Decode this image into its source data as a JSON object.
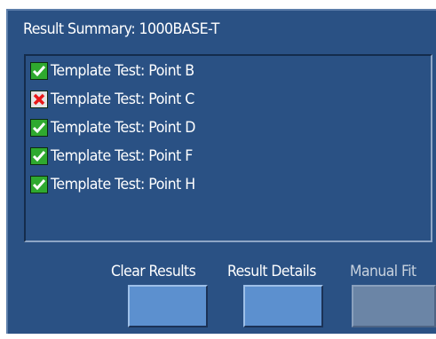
{
  "panel": {
    "title": "Result Summary: 1000BASE-T"
  },
  "results": [
    {
      "label": "Template Test: Point B",
      "status": "pass",
      "icon": "checkmark-icon"
    },
    {
      "label": "Template Test: Point C",
      "status": "fail",
      "icon": "x-icon"
    },
    {
      "label": "Template Test: Point D",
      "status": "pass",
      "icon": "checkmark-icon"
    },
    {
      "label": "Template Test: Point F",
      "status": "pass",
      "icon": "checkmark-icon"
    },
    {
      "label": "Template Test: Point H",
      "status": "pass",
      "icon": "checkmark-icon"
    }
  ],
  "buttons": {
    "clear_results": "Clear Results",
    "result_details": "Result Details",
    "manual_fit": "Manual Fit"
  },
  "colors": {
    "panel_bg": "#2a5184",
    "pass": "#2fa92f",
    "fail": "#e81818",
    "button": "#5c90cf",
    "button_disabled": "#6b85a6"
  }
}
